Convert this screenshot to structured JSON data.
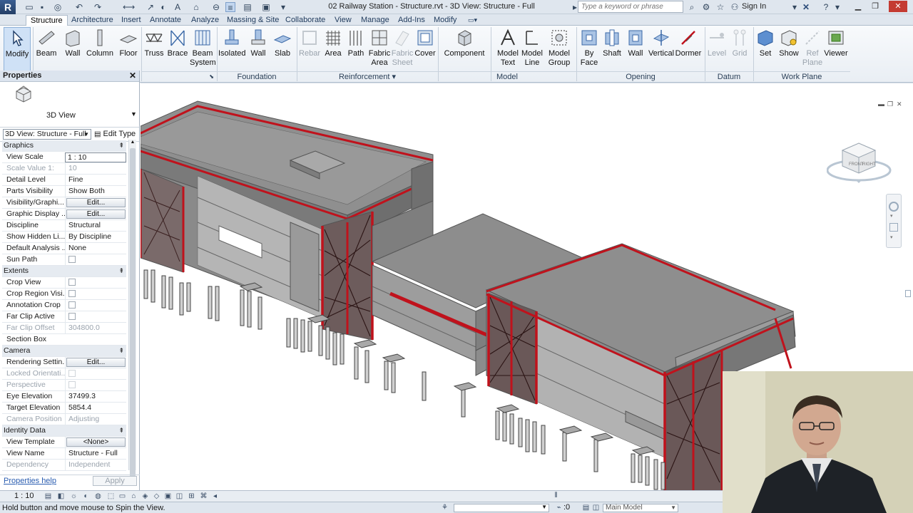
{
  "app_letter": "R",
  "document_title": "02 Railway Station - Structure.rvt - 3D View: Structure - Full",
  "search_placeholder": "Type a keyword or phrase",
  "sign_in": "Sign In",
  "tabs": [
    "Structure",
    "Architecture",
    "Insert",
    "Annotate",
    "Analyze",
    "Massing & Site",
    "Collaborate",
    "View",
    "Manage",
    "Add-Ins",
    "Modify"
  ],
  "ribbon": {
    "modify": "Modify",
    "beam": "Beam",
    "wall": "Wall",
    "column": "Column",
    "floor": "Floor",
    "truss": "Truss",
    "brace": "Brace",
    "beam_system_1": "Beam",
    "beam_system_2": "System",
    "isolated": "Isolated",
    "wall_found": "Wall",
    "slab": "Slab",
    "rebar": "Rebar",
    "area": "Area",
    "path": "Path",
    "fabric_area_1": "Fabric",
    "fabric_area_2": "Area",
    "fabric_sheet_1": "Fabric",
    "fabric_sheet_2": "Sheet",
    "cover": "Cover",
    "component": "Component",
    "model_text_1": "Model",
    "model_text_2": "Text",
    "model_line_1": "Model",
    "model_line_2": "Line",
    "model_group_1": "Model",
    "model_group_2": "Group",
    "by_face_1": "By",
    "by_face_2": "Face",
    "shaft": "Shaft",
    "wall_open": "Wall",
    "vertical": "Vertical",
    "dormer": "Dormer",
    "level": "Level",
    "grid": "Grid",
    "set": "Set",
    "show": "Show",
    "ref_plane_1": "Ref",
    "ref_plane_2": "Plane",
    "viewer": "Viewer"
  },
  "panels": {
    "foundation": "Foundation",
    "reinforcement": "Reinforcement ▾",
    "model": "Model",
    "opening": "Opening",
    "datum": "Datum",
    "work_plane": "Work Plane"
  },
  "properties": {
    "title": "Properties",
    "type_name": "3D View",
    "instance_selector": "3D View: Structure - Full",
    "edit_type": "Edit Type",
    "rows": [
      {
        "kind": "group",
        "label": "Graphics"
      },
      {
        "kind": "input",
        "label": "View Scale",
        "value": "1 : 10"
      },
      {
        "kind": "grey",
        "label": "Scale Value    1:",
        "value": "10"
      },
      {
        "kind": "text",
        "label": "Detail Level",
        "value": "Fine"
      },
      {
        "kind": "text",
        "label": "Parts Visibility",
        "value": "Show Both"
      },
      {
        "kind": "button",
        "label": "Visibility/Graphi...",
        "value": "Edit..."
      },
      {
        "kind": "button",
        "label": "Graphic Display ...",
        "value": "Edit..."
      },
      {
        "kind": "text",
        "label": "Discipline",
        "value": "Structural"
      },
      {
        "kind": "text",
        "label": "Show Hidden Li...",
        "value": "By Discipline"
      },
      {
        "kind": "text",
        "label": "Default Analysis ...",
        "value": "None"
      },
      {
        "kind": "check",
        "label": "Sun Path",
        "value": ""
      },
      {
        "kind": "group",
        "label": "Extents"
      },
      {
        "kind": "check",
        "label": "Crop View",
        "value": ""
      },
      {
        "kind": "check",
        "label": "Crop Region Visi...",
        "value": ""
      },
      {
        "kind": "check",
        "label": "Annotation Crop",
        "value": ""
      },
      {
        "kind": "check",
        "label": "Far Clip Active",
        "value": ""
      },
      {
        "kind": "grey",
        "label": "Far Clip Offset",
        "value": "304800.0"
      },
      {
        "kind": "text",
        "label": "Section Box",
        "value": ""
      },
      {
        "kind": "group",
        "label": "Camera"
      },
      {
        "kind": "button",
        "label": "Rendering Settin...",
        "value": "Edit..."
      },
      {
        "kind": "greycheck",
        "label": "Locked Orientati...",
        "value": ""
      },
      {
        "kind": "greycheck",
        "label": "Perspective",
        "value": ""
      },
      {
        "kind": "text",
        "label": "Eye Elevation",
        "value": "37499.3"
      },
      {
        "kind": "text",
        "label": "Target Elevation",
        "value": "5854.4"
      },
      {
        "kind": "grey",
        "label": "Camera Position",
        "value": "Adjusting"
      },
      {
        "kind": "group",
        "label": "Identity Data"
      },
      {
        "kind": "button",
        "label": "View Template",
        "value": "<None>"
      },
      {
        "kind": "text",
        "label": "View Name",
        "value": "Structure - Full"
      },
      {
        "kind": "grey",
        "label": "Dependency",
        "value": "Independent"
      }
    ],
    "help": "Properties help",
    "apply": "Apply"
  },
  "view_scale": "1 : 10",
  "status_text": "Hold button and move mouse to Spin the View.",
  "coordinate": ":0",
  "active_model": "Main Model",
  "viewcube": {
    "front": "FRONT",
    "right": "RIGHT"
  },
  "colors": {
    "accent": "#c0121c",
    "slab": "#9a9a9a",
    "ribbon_bg": "#eef2f6"
  },
  "icons": [
    "save-icon",
    "undo-icon",
    "redo-icon",
    "search-icon",
    "user-icon",
    "help-icon",
    "close-icon",
    "navigation-wheel-icon",
    "zoom-icon"
  ]
}
